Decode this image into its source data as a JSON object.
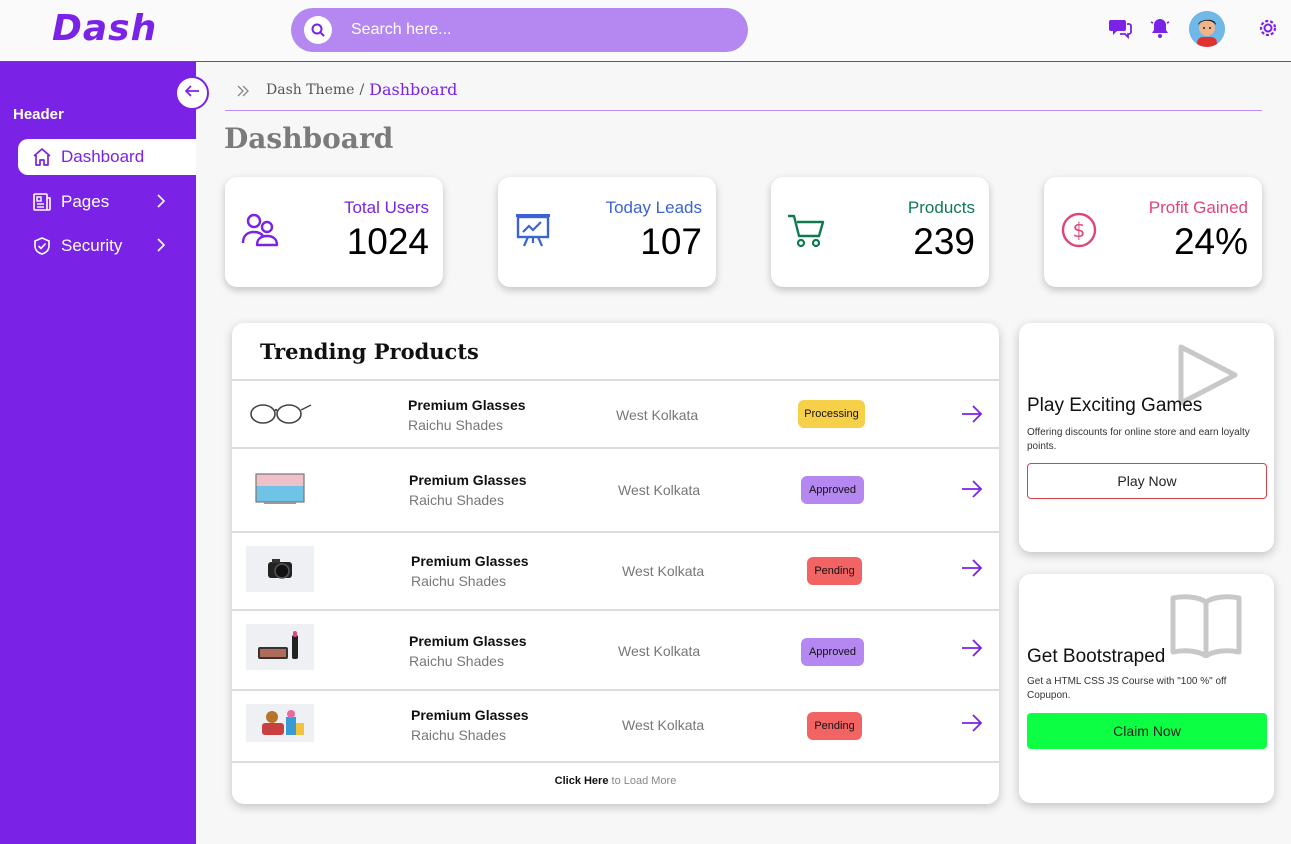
{
  "app": {
    "logo": "Dash"
  },
  "search": {
    "placeholder": "Search here..."
  },
  "sidebar": {
    "header": "Header",
    "items": [
      {
        "label": "Dashboard",
        "icon": "home-icon",
        "active": true
      },
      {
        "label": "Pages",
        "icon": "pages-icon",
        "active": false
      },
      {
        "label": "Security",
        "icon": "shield-icon",
        "active": false
      }
    ]
  },
  "breadcrumb": {
    "root": "Dash Theme",
    "separator": "/",
    "current": "Dashboard"
  },
  "page": {
    "title": "Dashboard"
  },
  "stats": [
    {
      "label": "Total Users",
      "value": "1024",
      "color": "#7a22e6",
      "icon": "users-icon"
    },
    {
      "label": "Today Leads",
      "value": "107",
      "color": "#3b63d4",
      "icon": "presentation-chart-icon"
    },
    {
      "label": "Products",
      "value": "239",
      "color": "#0f7a4f",
      "icon": "cart-icon"
    },
    {
      "label": "Profit Gained",
      "value": "24%",
      "color": "#e0457a",
      "icon": "dollar-icon"
    }
  ],
  "trending": {
    "title": "Trending Products",
    "rows": [
      {
        "name": "Premium Glasses",
        "brand": "Raichu Shades",
        "location": "West Kolkata",
        "status": "Processing",
        "status_color": "#f7d04a",
        "image": "glasses-image"
      },
      {
        "name": "Premium Glasses",
        "brand": "Raichu Shades",
        "location": "West Kolkata",
        "status": "Approved",
        "status_color": "#b587f0",
        "image": "tv-image"
      },
      {
        "name": "Premium Glasses",
        "brand": "Raichu Shades",
        "location": "West Kolkata",
        "status": "Pending",
        "status_color": "#f26464",
        "image": "camera-image"
      },
      {
        "name": "Premium Glasses",
        "brand": "Raichu Shades",
        "location": "West Kolkata",
        "status": "Approved",
        "status_color": "#b587f0",
        "image": "makeup-image"
      },
      {
        "name": "Premium Glasses",
        "brand": "Raichu Shades",
        "location": "West Kolkata",
        "status": "Pending",
        "status_color": "#f26464",
        "image": "toys-image"
      }
    ],
    "load_more_bold": "Click Here",
    "load_more_rest": "to Load More"
  },
  "promos": [
    {
      "title": "Play Exciting Games",
      "description": "Offering discounts for online store and earn loyalty points.",
      "button": "Play Now",
      "icon": "play-icon",
      "button_color": "#ffffff",
      "button_border": "#d9434d"
    },
    {
      "title": "Get Bootstraped",
      "description": "Get a HTML CSS JS Course with \"100 %\" off Copupon.",
      "button": "Claim Now",
      "icon": "book-icon",
      "button_color": "#0dff43",
      "button_border": "#0dff43"
    }
  ],
  "colors": {
    "brand": "#7a22e6",
    "search_bg": "#b587f0"
  }
}
